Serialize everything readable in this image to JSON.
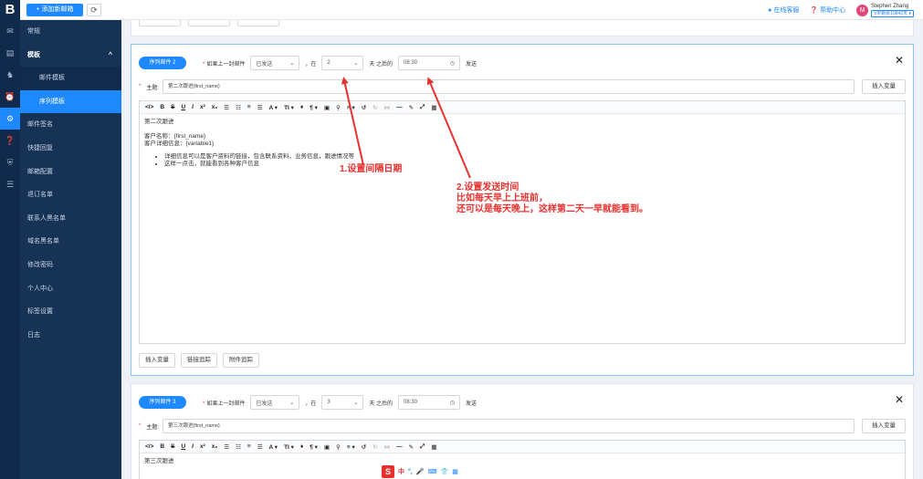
{
  "topbar": {
    "logo": "B",
    "add_button": "+ 添加新邮箱",
    "refresh_icon": "⟳",
    "online_service": "在线客服",
    "help_center": "帮助中心",
    "avatar_letter": "M",
    "user_name": "Stephen Zhang",
    "user_badge": "VIP剩余10842天 ▾"
  },
  "iconbar": [
    {
      "icon": "envelope-icon",
      "glyph": "✉"
    },
    {
      "icon": "list-icon",
      "glyph": "▤"
    },
    {
      "icon": "bike-icon",
      "glyph": "♞"
    },
    {
      "icon": "alarm-icon",
      "glyph": "⏰"
    },
    {
      "icon": "gear-icon",
      "glyph": "⚙"
    },
    {
      "icon": "question-icon",
      "glyph": "❓"
    },
    {
      "icon": "shield-icon",
      "glyph": "⛨"
    },
    {
      "icon": "menu-icon",
      "glyph": "☰"
    }
  ],
  "sidebar": {
    "items": [
      {
        "label": "常规"
      },
      {
        "label": "模板",
        "chevron": "^"
      },
      {
        "label": "邮件模板"
      },
      {
        "label": "序列模板"
      },
      {
        "label": "邮件签名"
      },
      {
        "label": "快捷回复"
      },
      {
        "label": "邮箱配置"
      },
      {
        "label": "退订名单"
      },
      {
        "label": "联系人黑名单"
      },
      {
        "label": "域名黑名单"
      },
      {
        "label": "修改密码"
      },
      {
        "label": "个人中心"
      },
      {
        "label": "标签设置"
      },
      {
        "label": "日志"
      }
    ]
  },
  "card1": {
    "badge": "序列邮件 2",
    "cond_label": "如果上一封邮件",
    "status_value": "已发送",
    "comma_zai": "，在",
    "days_value": "2",
    "days_suffix": "天 之后的",
    "time_value": "08:30",
    "send_label": "发送",
    "close": "✕",
    "subject_label": "主题:",
    "subject_value": "第二次跟进{first_name}",
    "insert_var": "插入变量",
    "body": {
      "line1": "第二次跟进",
      "line2": "客户名称：{first_name}",
      "line3": "客户详细信息：{variable1}",
      "bullet1": "详细信息可以是客户资料的链接，包含联系资料，业务信息，跟进情况等",
      "bullet2": "这样一点击，就能看到各种客户信息"
    },
    "footer": [
      "插入变量",
      "链接追踪",
      "附件追踪"
    ]
  },
  "card2": {
    "badge": "序列邮件 3",
    "cond_label": "如果上一封邮件",
    "status_value": "已发送",
    "comma_zai": "，在",
    "days_value": "3",
    "days_suffix": "天 之后的",
    "time_value": "08:30",
    "send_label": "发送",
    "close": "✕",
    "subject_label": "主题:",
    "subject_value": "第三次跟进{first_name}",
    "insert_var": "插入变量",
    "body_line1": "第三次跟进"
  },
  "toolbar": [
    "</>",
    "B",
    "S",
    "U",
    "I",
    "x²",
    "x₂",
    "☰",
    "☷",
    "≡",
    "☰",
    "A ▾",
    "TI ▾",
    "♦",
    "¶ ▾",
    "▣",
    "⚲",
    "≡ ▾",
    "↺",
    "↻",
    "⋈",
    "—",
    "✎",
    "⤢",
    "▦"
  ],
  "annotations": {
    "a1": "1.设置间隔日期",
    "a2_line1": "2.设置发送时间",
    "a2_line2": "比如每天早上上班前，",
    "a2_line3": "还可以是每天晚上，这样第二天一早就能看到。"
  },
  "ime": {
    "logo": "S",
    "zh": "中",
    "punct": "°,",
    "mic": "🎤",
    "kbd": "⌨",
    "shirt": "👕",
    "grid": "▦"
  }
}
